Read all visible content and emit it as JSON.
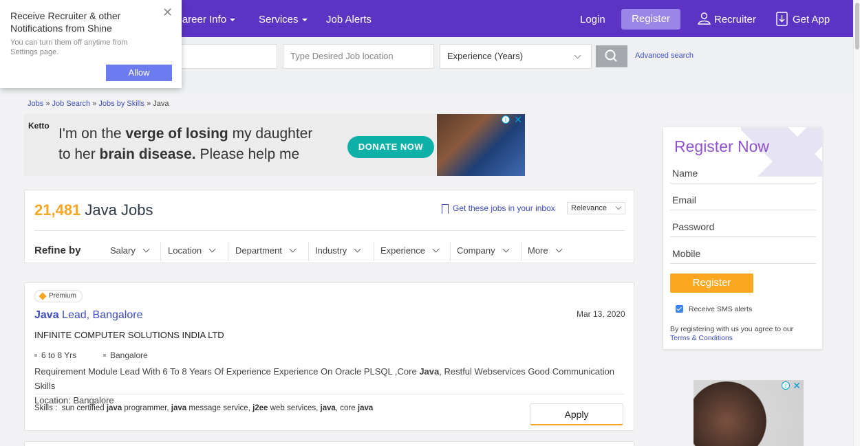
{
  "nav": {
    "career_info": "Career Info",
    "services": "Services",
    "job_alerts": "Job Alerts",
    "login": "Login",
    "register": "Register",
    "recruiter": "Recruiter",
    "get_app": "Get App"
  },
  "search": {
    "location_placeholder": "Type Desired Job location",
    "experience_label": "Experience (Years)",
    "advanced": "Advanced search"
  },
  "breadcrumb": {
    "jobs": "Jobs",
    "job_search": "Job Search",
    "jobs_by_skills": "Jobs by Skills",
    "current": "Java",
    "sep": "»"
  },
  "ad": {
    "logo": "Ketto",
    "line1_a": "I'm on the ",
    "line1_b": "verge of losing",
    "line1_c": " my daughter",
    "line2_a": "to her ",
    "line2_b": "brain disease.",
    "line2_c": " Please help me",
    "donate": "DONATE NOW"
  },
  "results": {
    "count": "21,481",
    "label": "Java Jobs",
    "get_jobs": "Get these jobs in your inbox",
    "sort": "Relevance",
    "refine_label": "Refine by",
    "filters": [
      "Salary",
      "Location",
      "Department",
      "Industry",
      "Experience",
      "Company",
      "More"
    ]
  },
  "job": {
    "badge": "Premium",
    "title_bold": "Java",
    "title_rest": " Lead, Bangalore",
    "date": "Mar 13, 2020",
    "company": "INFINITE COMPUTER SOLUTIONS INDIA LTD",
    "experience": "6 to 8 Yrs",
    "location": "Bangalore",
    "desc_1": "Requirement Module Lead With 6 To 8 Years Of Experience Experience On Oracle PLSQL ,Core ",
    "desc_bold": "Java",
    "desc_2": ", Restful Webservices Good Communication Skills",
    "desc_location": "Location: Bangalore",
    "skills_label": "Skills : ",
    "skills": [
      {
        "pre": "sun certified ",
        "bold": "java",
        "post": " programmer, "
      },
      {
        "pre": "",
        "bold": "java",
        "post": " message service, "
      },
      {
        "pre": "",
        "bold": "j2ee",
        "post": " web services, "
      },
      {
        "pre": "",
        "bold": "java",
        "post": ", core "
      },
      {
        "pre": "",
        "bold": "java",
        "post": ""
      }
    ],
    "apply": "Apply"
  },
  "register": {
    "title": "Register Now",
    "name": "Name",
    "email": "Email",
    "password": "Password",
    "mobile": "Mobile",
    "button": "Register",
    "sms": "Receive SMS alerts",
    "terms_text": "By registering with us you agree to our",
    "terms_link": "Terms & Conditions"
  },
  "popup": {
    "title": "Receive Recruiter & other Notifications from Shine",
    "subtitle": "You can turn them off anytime from Settings page.",
    "allow": "Allow"
  },
  "colors": {
    "nav": "#5b34c3",
    "accent": "#f5a623",
    "link": "#3d4cc1",
    "register_title": "#8e51cf"
  }
}
